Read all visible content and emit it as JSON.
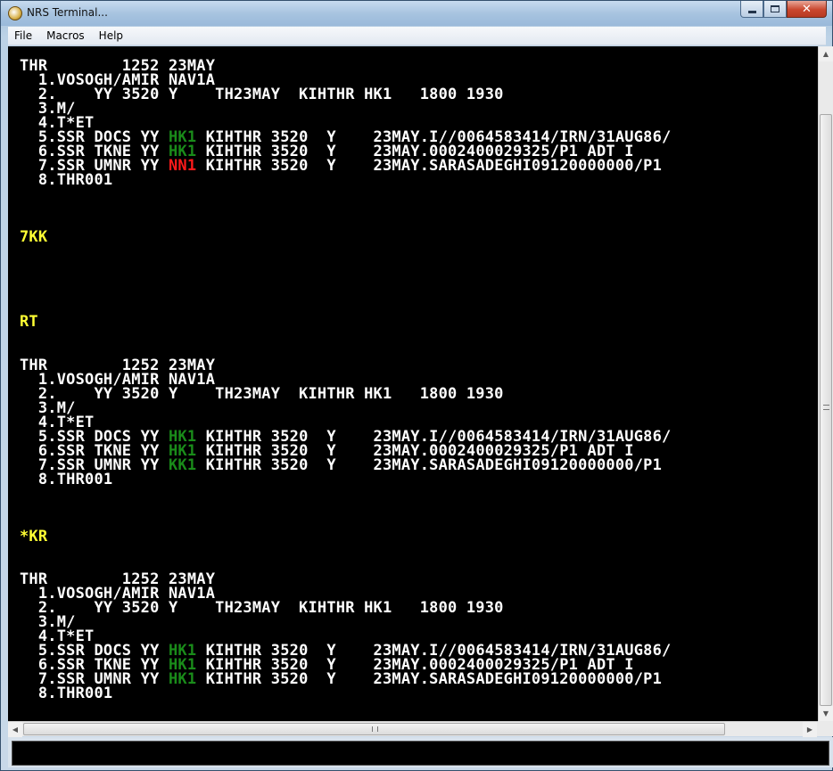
{
  "window": {
    "title": "NRS Terminal...",
    "minimize_label": "",
    "maximize_label": "",
    "close_label": "✕"
  },
  "menu": {
    "items": [
      "File",
      "Macros",
      "Help"
    ]
  },
  "colors": {
    "background": "#000000",
    "text": "#ffffff",
    "prompt": "#ffff33",
    "status_ok": "#1a8c1a",
    "status_error": "#ff1a1a"
  },
  "terminal": {
    "lines": [
      {
        "segments": [
          {
            "t": "THR        1252 23MAY",
            "c": "white"
          }
        ]
      },
      {
        "segments": [
          {
            "t": "  1.VOSOGH/AMIR NAV1A",
            "c": "white"
          }
        ]
      },
      {
        "segments": [
          {
            "t": "  2.    YY 3520 Y    TH23MAY  KIHTHR HK1   1800 1930",
            "c": "white"
          }
        ]
      },
      {
        "segments": [
          {
            "t": "  3.M/",
            "c": "white"
          }
        ]
      },
      {
        "segments": [
          {
            "t": "  4.T*ET",
            "c": "white"
          }
        ]
      },
      {
        "segments": [
          {
            "t": "  5.SSR DOCS YY ",
            "c": "white"
          },
          {
            "t": "HK1",
            "c": "green"
          },
          {
            "t": " KIHTHR 3520  Y    23MAY.I//0064583414/IRN/31AUG86/",
            "c": "white"
          }
        ]
      },
      {
        "segments": [
          {
            "t": "  6.SSR TKNE YY ",
            "c": "white"
          },
          {
            "t": "HK1",
            "c": "green"
          },
          {
            "t": " KIHTHR 3520  Y    23MAY.0002400029325/P1 ADT I",
            "c": "white"
          }
        ]
      },
      {
        "segments": [
          {
            "t": "  7.SSR UMNR YY ",
            "c": "white"
          },
          {
            "t": "NN1",
            "c": "red"
          },
          {
            "t": " KIHTHR 3520  Y    23MAY.SARASADEGHI09120000000/P1",
            "c": "white"
          }
        ]
      },
      {
        "segments": [
          {
            "t": "  8.THR001",
            "c": "white"
          }
        ]
      },
      {
        "segments": [
          {
            "t": "7KK",
            "c": "yellow"
          }
        ]
      },
      {
        "segments": [
          {
            "t": "RT",
            "c": "yellow"
          }
        ]
      },
      {
        "segments": [
          {
            "t": "THR        1252 23MAY",
            "c": "white"
          }
        ]
      },
      {
        "segments": [
          {
            "t": "  1.VOSOGH/AMIR NAV1A",
            "c": "white"
          }
        ]
      },
      {
        "segments": [
          {
            "t": "  2.    YY 3520 Y    TH23MAY  KIHTHR HK1   1800 1930",
            "c": "white"
          }
        ]
      },
      {
        "segments": [
          {
            "t": "  3.M/",
            "c": "white"
          }
        ]
      },
      {
        "segments": [
          {
            "t": "  4.T*ET",
            "c": "white"
          }
        ]
      },
      {
        "segments": [
          {
            "t": "  5.SSR DOCS YY ",
            "c": "white"
          },
          {
            "t": "HK1",
            "c": "green"
          },
          {
            "t": " KIHTHR 3520  Y    23MAY.I//0064583414/IRN/31AUG86/",
            "c": "white"
          }
        ]
      },
      {
        "segments": [
          {
            "t": "  6.SSR TKNE YY ",
            "c": "white"
          },
          {
            "t": "HK1",
            "c": "green"
          },
          {
            "t": " KIHTHR 3520  Y    23MAY.0002400029325/P1 ADT I",
            "c": "white"
          }
        ]
      },
      {
        "segments": [
          {
            "t": "  7.SSR UMNR YY ",
            "c": "white"
          },
          {
            "t": "KK1",
            "c": "green"
          },
          {
            "t": " KIHTHR 3520  Y    23MAY.SARASADEGHI09120000000/P1",
            "c": "white"
          }
        ]
      },
      {
        "segments": [
          {
            "t": "  8.THR001",
            "c": "white"
          }
        ]
      },
      {
        "segments": [
          {
            "t": "*KR",
            "c": "yellow"
          }
        ]
      },
      {
        "segments": [
          {
            "t": "THR        1252 23MAY",
            "c": "white"
          }
        ]
      },
      {
        "segments": [
          {
            "t": "  1.VOSOGH/AMIR NAV1A",
            "c": "white"
          }
        ]
      },
      {
        "segments": [
          {
            "t": "  2.    YY 3520 Y    TH23MAY  KIHTHR HK1   1800 1930",
            "c": "white"
          }
        ]
      },
      {
        "segments": [
          {
            "t": "  3.M/",
            "c": "white"
          }
        ]
      },
      {
        "segments": [
          {
            "t": "  4.T*ET",
            "c": "white"
          }
        ]
      },
      {
        "segments": [
          {
            "t": "  5.SSR DOCS YY ",
            "c": "white"
          },
          {
            "t": "HK1",
            "c": "green"
          },
          {
            "t": " KIHTHR 3520  Y    23MAY.I//0064583414/IRN/31AUG86/",
            "c": "white"
          }
        ]
      },
      {
        "segments": [
          {
            "t": "  6.SSR TKNE YY ",
            "c": "white"
          },
          {
            "t": "HK1",
            "c": "green"
          },
          {
            "t": " KIHTHR 3520  Y    23MAY.0002400029325/P1 ADT I",
            "c": "white"
          }
        ]
      },
      {
        "segments": [
          {
            "t": "  7.SSR UMNR YY ",
            "c": "white"
          },
          {
            "t": "HK1",
            "c": "green"
          },
          {
            "t": " KIHTHR 3520  Y    23MAY.SARASADEGHI09120000000/P1",
            "c": "white"
          }
        ]
      },
      {
        "segments": [
          {
            "t": "  8.THR001",
            "c": "white"
          }
        ]
      }
    ]
  },
  "command": {
    "value": ""
  }
}
